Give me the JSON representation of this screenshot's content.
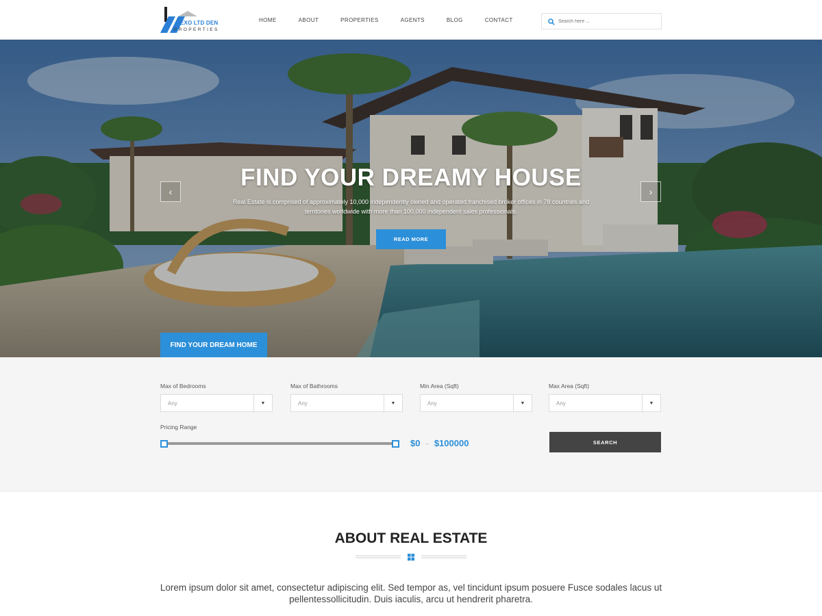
{
  "brand": {
    "name_top": "HEXO LTD DEN",
    "name_bottom": "PROPERTIES",
    "color": "#2b7fd6"
  },
  "nav": {
    "items": [
      "HOME",
      "ABOUT",
      "PROPERTIES",
      "AGENTS",
      "BLOG",
      "CONTACT"
    ]
  },
  "search": {
    "placeholder": "Search here ...",
    "icon": "search-icon"
  },
  "hero": {
    "title": "FIND YOUR DREAMY HOUSE",
    "text": "Real Estate is comprised of approximately 10,000 independently owned and operated franchised broker offices in 78 countries and territories worldwide with more than 100,000 independent sales professionals.",
    "read_more": "READ MORE",
    "prev_icon": "chevron-left-icon",
    "next_icon": "chevron-right-icon",
    "tab_label": "FIND YOUR DREAM HOME"
  },
  "filters": {
    "bedrooms": {
      "label": "Max of Bedrooms",
      "value": "Any"
    },
    "bathrooms": {
      "label": "Max of Bathrooms",
      "value": "Any"
    },
    "min_area": {
      "label": "Min Area (Sqft)",
      "value": "Any"
    },
    "max_area": {
      "label": "Max Area (Sqft)",
      "value": "Any"
    },
    "pricing_label": "Pricing Range",
    "price_min": "$0",
    "price_sep": "-",
    "price_max": "$100000",
    "search_button": "SEARCH"
  },
  "about": {
    "title": "ABOUT REAL ESTATE",
    "text": "Lorem ipsum dolor sit amet, consectetur adipiscing elit. Sed tempor as, vel tincidunt ipsum posuere Fusce sodales lacus ut pellentessollicitudin. Duis iaculis, arcu ut hendrerit pharetra."
  },
  "colors": {
    "accent": "#2c8fd9",
    "dark_button": "#444444"
  }
}
